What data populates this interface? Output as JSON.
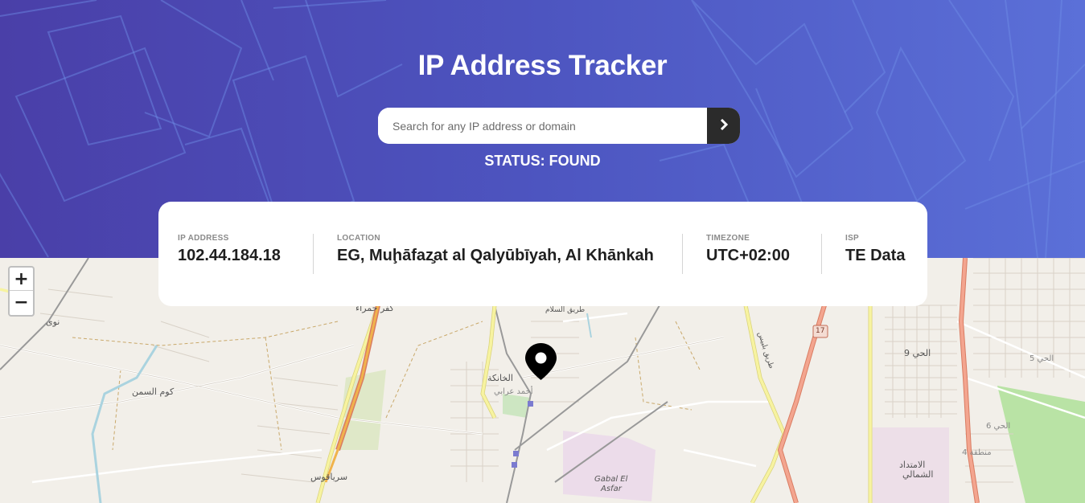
{
  "header": {
    "title": "IP Address Tracker",
    "search_placeholder": "Search for any IP address or domain",
    "search_value": "",
    "submit_icon": "chevron-right-icon",
    "status": "STATUS: FOUND"
  },
  "info": {
    "ip_label": "IP ADDRESS",
    "ip_value": "102.44.184.18",
    "location_label": "LOCATION",
    "location_value": "EG, Muḩāfaz̧at al Qalyūbīyah, Al Khānkah",
    "timezone_label": "TIMEZONE",
    "timezone_value": "UTC+02:00",
    "isp_label": "ISP",
    "isp_value": "TE Data"
  },
  "map": {
    "zoom_in": "+",
    "zoom_out": "−",
    "marker_icon": "location-pin-icon",
    "labels": {
      "nawa": "نوى",
      "kafr_hamra": "كفر حمراء",
      "kom_samman": "كوم السمن",
      "khanka": "الخانكة",
      "ahmed_orabi": "أحمد عرابي",
      "sirya": "سرياقوس",
      "gabal": "Gabal El",
      "asfar": "Asfar",
      "hay9": "الحي 9",
      "hay5": "الحي 5",
      "hay6": "الحي 6",
      "mantiqa4": "منطقة 4",
      "imtidad1": "الامتداد",
      "imtidad2": "الشمالي",
      "road_17": "17",
      "salam": "طريق السلام",
      "belbes": "طريق بلبيس"
    }
  },
  "colors": {
    "header_start": "#4a3fa8",
    "header_end": "#5b70d8",
    "button": "#2b2b2b",
    "road_primary": "#e8927c",
    "road_secondary": "#f7f3a0"
  }
}
